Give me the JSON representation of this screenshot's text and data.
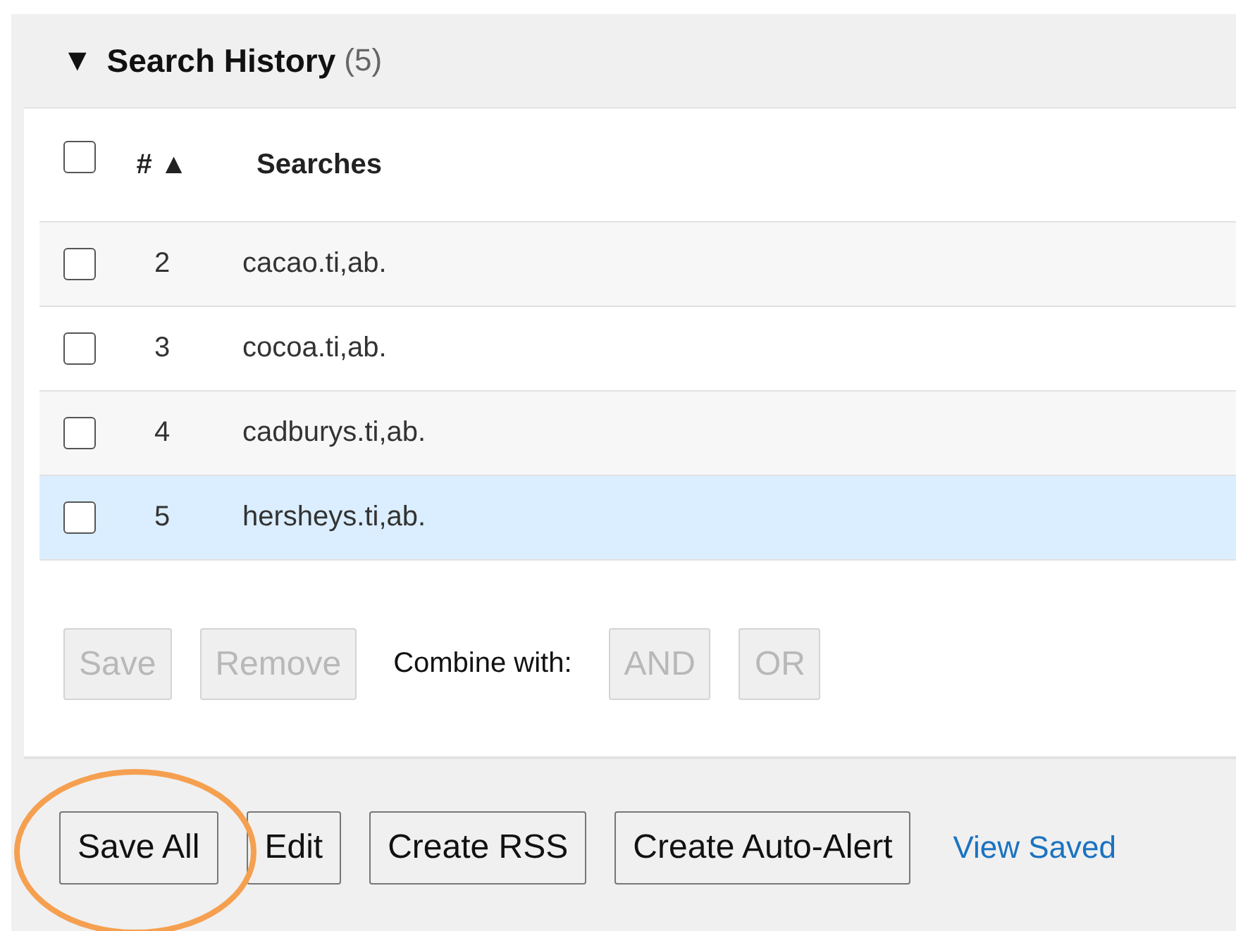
{
  "panel": {
    "expanded": true,
    "toggle": "▼",
    "title": "Search History",
    "count": "(5)"
  },
  "table": {
    "select_all": {
      "checked": false
    },
    "columns": [
      "# ▲",
      "Searches"
    ],
    "rows": [
      {
        "checked": false,
        "selected": false,
        "number": "2",
        "search": "cacao.ti,ab."
      },
      {
        "checked": false,
        "selected": false,
        "number": "3",
        "search": "cocoa.ti,ab."
      },
      {
        "checked": false,
        "selected": false,
        "number": "4",
        "search": "cadburys.ti,ab."
      },
      {
        "checked": false,
        "selected": true,
        "number": "5",
        "search": "hersheys.ti,ab."
      }
    ]
  },
  "row_actions": [
    {
      "kind": "button",
      "label": "Save",
      "disabled": true
    },
    {
      "kind": "button",
      "label": "Remove",
      "disabled": true
    },
    {
      "kind": "label",
      "label": "Combine with:"
    },
    {
      "kind": "button",
      "label": "AND",
      "disabled": true
    },
    {
      "kind": "button",
      "label": "OR",
      "disabled": true
    }
  ],
  "footer_actions": [
    {
      "kind": "button",
      "label": "Save All",
      "disabled": false,
      "highlighted": true
    },
    {
      "kind": "button",
      "label": "Edit",
      "disabled": false,
      "highlighted": false
    },
    {
      "kind": "button",
      "label": "Create RSS",
      "disabled": false,
      "highlighted": false
    },
    {
      "kind": "button",
      "label": "Create Auto-Alert",
      "disabled": false,
      "highlighted": false
    },
    {
      "kind": "link",
      "label": "View Saved"
    }
  ]
}
